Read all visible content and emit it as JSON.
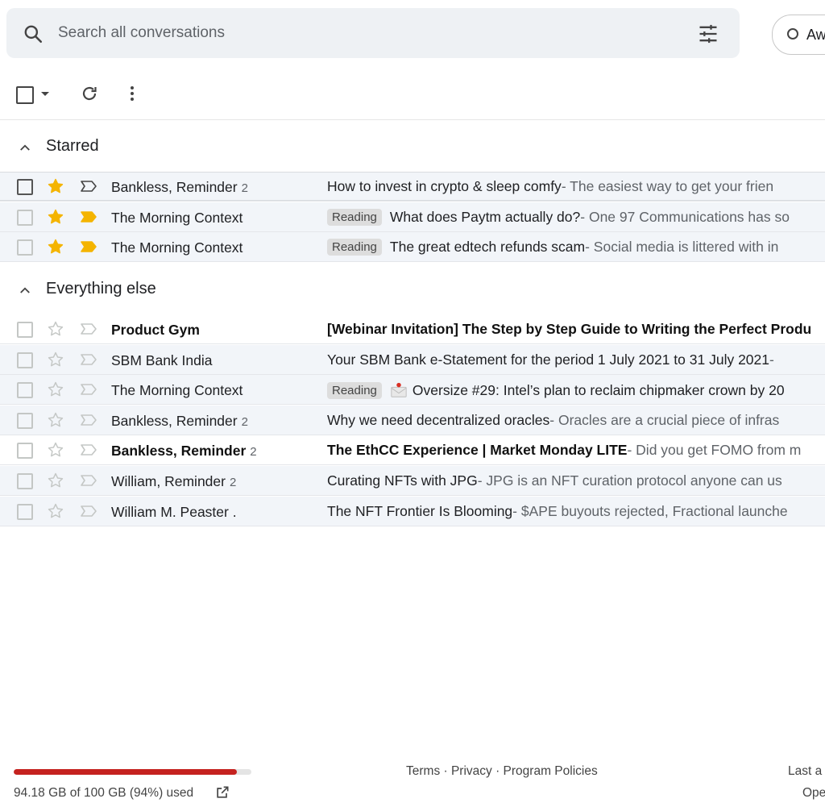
{
  "search": {
    "placeholder": "Search all conversations"
  },
  "status": {
    "label": "Aw"
  },
  "sections": {
    "starred": {
      "title": "Starred"
    },
    "everything": {
      "title": "Everything else"
    }
  },
  "starred_rows": [
    {
      "sender": "Bankless, Reminder",
      "count": "2",
      "label": "",
      "subject": "How to invest in crypto & sleep comfy",
      "snippet": " - The easiest way to get your frien"
    },
    {
      "sender": "The Morning Context",
      "count": "",
      "label": "Reading",
      "subject": "What does Paytm actually do?",
      "snippet": " - One 97 Communications has so"
    },
    {
      "sender": "The Morning Context",
      "count": "",
      "label": "Reading",
      "subject": "The great edtech refunds scam",
      "snippet": " - Social media is littered with in"
    }
  ],
  "other_rows": [
    {
      "sender": "Product Gym",
      "count": "",
      "label": "",
      "subject": "[Webinar Invitation] The Step by Step Guide to Writing the Perfect Produ",
      "snippet": ""
    },
    {
      "sender": "SBM Bank India",
      "count": "",
      "label": "",
      "subject": "Your SBM Bank e-Statement for the period 1 July 2021 to 31 July 2021",
      "snippet": " -"
    },
    {
      "sender": "The Morning Context",
      "count": "",
      "label": "Reading",
      "subject": "Oversize #29: Intel’s plan to reclaim chipmaker crown by 20",
      "snippet": ""
    },
    {
      "sender": "Bankless, Reminder",
      "count": "2",
      "label": "",
      "subject": "Why we need decentralized oracles",
      "snippet": " - Oracles are a crucial piece of infras"
    },
    {
      "sender": "Bankless, Reminder",
      "count": "2",
      "label": "",
      "subject": "The EthCC Experience | Market Monday LITE",
      "snippet": " - Did you get FOMO from m"
    },
    {
      "sender": "William, Reminder",
      "count": "2",
      "label": "",
      "subject": "Curating NFTs with JPG",
      "snippet": " - JPG is an NFT curation protocol anyone can us"
    },
    {
      "sender": "William M. Peaster .",
      "count": "",
      "label": "",
      "subject": "The NFT Frontier Is Blooming",
      "snippet": " - $APE buyouts rejected, Fractional launche"
    }
  ],
  "footer": {
    "storage_text": "94.18 GB of 100 GB (94%) used",
    "storage_used_fraction": 0.94,
    "links": "Terms · Privacy · Program Policies",
    "right_top": "Last a",
    "right_bottom": "Ope"
  },
  "colors": {
    "star": "#f4b400",
    "important": "#f4b400",
    "quota": "#c5221f"
  },
  "icons": [
    "search-icon",
    "tune-icon",
    "refresh-icon",
    "more-vert-icon",
    "chevron-up-icon",
    "star-icon",
    "important-marker-icon",
    "envelope-icon",
    "open-in-new-icon"
  ]
}
